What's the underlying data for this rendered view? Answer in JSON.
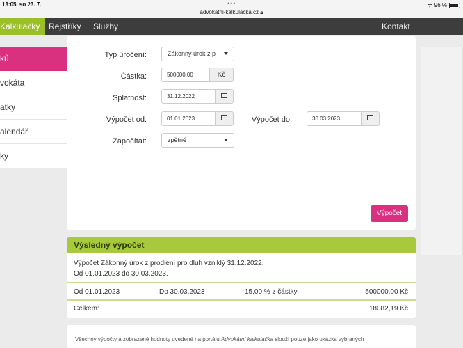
{
  "statusbar": {
    "time": "13:05",
    "date": "so 23. 7.",
    "url": "advokatni-kalkulacka.cz",
    "battery": "96 %"
  },
  "navbar": {
    "items": [
      {
        "label": "Kalkulačky",
        "active": true
      },
      {
        "label": "Rejstříky"
      },
      {
        "label": "Služby"
      }
    ],
    "contact": "Kontakt"
  },
  "sidebar": {
    "items": [
      {
        "label": "ků"
      },
      {
        "label": "vokáta"
      },
      {
        "label": "atky"
      },
      {
        "label": "alendář"
      },
      {
        "label": "ky"
      }
    ]
  },
  "form": {
    "typ_label": "Typ úročení:",
    "typ_value": "Zákonný úrok z p",
    "castka_label": "Částka:",
    "castka_value": "500000,00",
    "castka_currency": "Kč",
    "splatnost_label": "Splatnost:",
    "splatnost_value": "31.12.2022",
    "vypocet_od_label": "Výpočet od:",
    "vypocet_od_value": "01.01.2023",
    "vypocet_do_label": "Výpočet do:",
    "vypocet_do_value": "30.03.2023",
    "zapocitat_label": "Započítat:",
    "zapocitat_value": "zpětně",
    "submit_label": "Výpočet"
  },
  "result": {
    "title": "Výsledný výpočet",
    "desc_line1": "Výpočet Zákonný úrok z prodlení pro dluh vzniklý 31.12.2022.",
    "desc_line2": "Od 01.01.2023 do 30.03.2023.",
    "row": {
      "from": "Od 01.01.2023",
      "to": "Do 30.03.2023",
      "rate": "15,00 % z částky",
      "amount": "500000,00 Kč"
    },
    "total_label": "Celkem:",
    "total_value": "18082,19 Kč"
  },
  "note": {
    "text_before": "Všechny výpočty a zobrazené hodnoty uvedené na portálu ",
    "brand": "Advokátní kalkulačka",
    "text_after": " slouží pouze jako ukázka vybraných"
  },
  "colors": {
    "accent_pink": "#d9307f",
    "accent_green": "#9bbf27",
    "navbar_bg": "#3d3d3d"
  }
}
